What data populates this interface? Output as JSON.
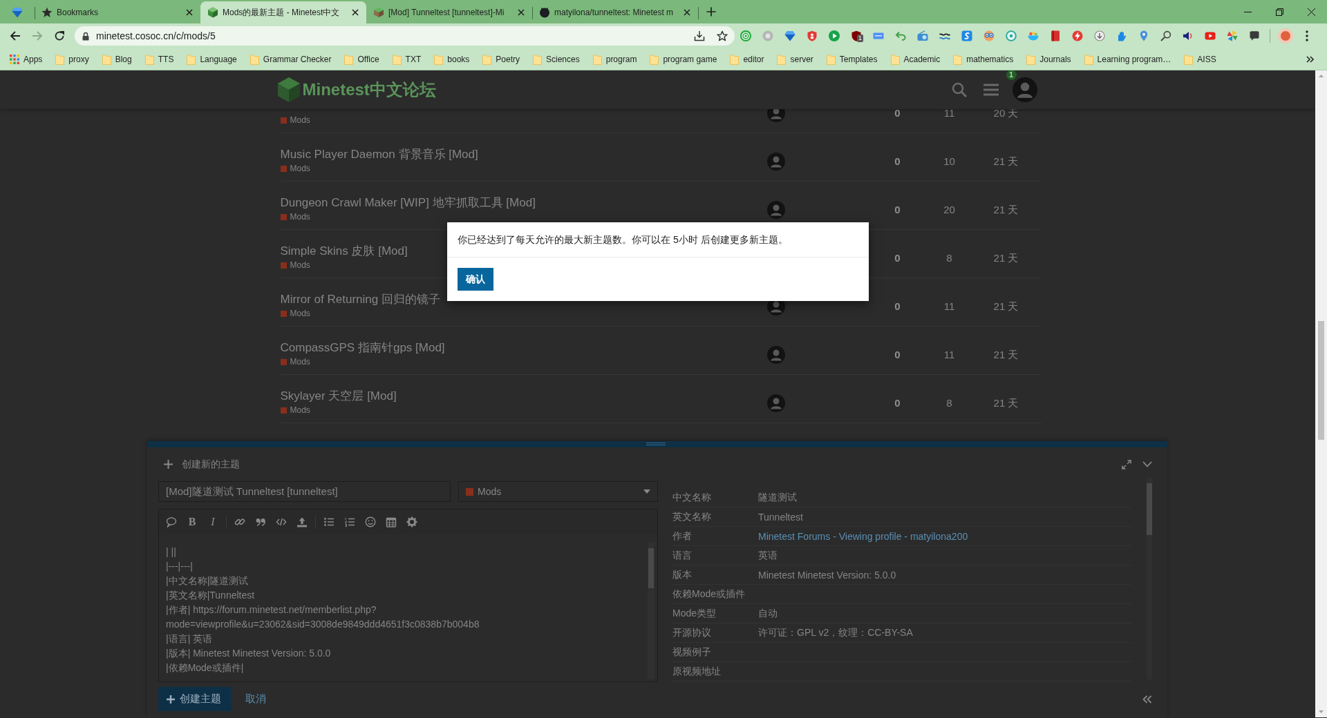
{
  "browser": {
    "tabs": [
      {
        "selected": false
      },
      {
        "title": "Bookmarks",
        "selected": false
      },
      {
        "title": "Mods的最新主题 - Minetest中文",
        "selected": true
      },
      {
        "title": "[Mod] Tunneltest [tunneltest]-Mi",
        "selected": false
      },
      {
        "title": "matyilona/tunneltest: Minetest m",
        "selected": false
      }
    ],
    "can_go_forward": false,
    "url": "minetest.cosoc.cn/c/mods/5",
    "extension_badge": "1",
    "bookmarks": [
      {
        "kind": "apps",
        "label": "Apps"
      },
      {
        "kind": "folder",
        "label": "proxy"
      },
      {
        "kind": "folder",
        "label": "Blog"
      },
      {
        "kind": "folder",
        "label": "TTS"
      },
      {
        "kind": "folder",
        "label": "Language"
      },
      {
        "kind": "folder",
        "label": "Grammar Checker"
      },
      {
        "kind": "folder",
        "label": "Office"
      },
      {
        "kind": "folder",
        "label": "TXT"
      },
      {
        "kind": "folder",
        "label": "books"
      },
      {
        "kind": "folder",
        "label": "Poetry"
      },
      {
        "kind": "folder",
        "label": "Sciences"
      },
      {
        "kind": "folder",
        "label": "program"
      },
      {
        "kind": "folder",
        "label": "program game"
      },
      {
        "kind": "folder",
        "label": "editor"
      },
      {
        "kind": "folder",
        "label": "server"
      },
      {
        "kind": "folder",
        "label": "Templates"
      },
      {
        "kind": "folder",
        "label": "Academic"
      },
      {
        "kind": "folder",
        "label": "mathematics"
      },
      {
        "kind": "folder",
        "label": "Journals"
      },
      {
        "kind": "folder",
        "label": "Learning program…"
      },
      {
        "kind": "folder",
        "label": "AISS"
      }
    ]
  },
  "header": {
    "site_title": "Minetest中文论坛",
    "notification_count": "1"
  },
  "topics": [
    {
      "category": "Mods",
      "avatar_shown": true,
      "replies": "0",
      "views": "11",
      "activity": "20 天"
    },
    {
      "title": "Music Player Daemon 背景音乐 [Mod]",
      "category": "Mods",
      "avatar_shown": true,
      "replies": "0",
      "views": "10",
      "activity": "21 天"
    },
    {
      "title": "Dungeon Crawl Maker [WIP] 地牢抓取工具 [Mod]",
      "category": "Mods",
      "avatar_shown": true,
      "replies": "0",
      "views": "20",
      "activity": "21 天"
    },
    {
      "title": "Simple Skins 皮肤 [Mod]",
      "category": "Mods",
      "avatar_shown": false,
      "replies": "0",
      "views": "8",
      "activity": "21 天"
    },
    {
      "title": "Mirror of Returning 回归的镜子",
      "category": "Mods",
      "avatar_shown": true,
      "replies": "0",
      "views": "11",
      "activity": "21 天"
    },
    {
      "title": "CompassGPS 指南针gps [Mod]",
      "category": "Mods",
      "avatar_shown": true,
      "replies": "0",
      "views": "11",
      "activity": "21 天"
    },
    {
      "title": "Skylayer 天空层 [Mod]",
      "category": "Mods",
      "avatar_shown": true,
      "replies": "0",
      "views": "8",
      "activity": "21 天"
    }
  ],
  "composer": {
    "heading": "创建新的主题",
    "title_value": "[Mod]隧道测试 Tunneltest [tunneltest]",
    "category": "Mods",
    "format_buttons": [
      "B",
      "I"
    ],
    "editor_lines": [
      "| ||",
      "|---|---|",
      "|中文名称|隧道测试",
      "|英文名称|Tunneltest",
      "|作者| https://forum.minetest.net/memberlist.php?",
      "mode=viewprofile&u=23062&sid=3008de9849ddd4651f3c0838b7b004b8",
      "|语言| 英语",
      "|版本| Minetest Minetest Version: 5.0.0",
      "|依赖Mode或插件|"
    ],
    "preview": [
      {
        "kind": "text",
        "label": "中文名称",
        "value": "隧道测试"
      },
      {
        "kind": "text",
        "label": "英文名称",
        "value": "Tunneltest"
      },
      {
        "kind": "link",
        "label": "作者",
        "value": "Minetest Forums - Viewing profile - matyilona200"
      },
      {
        "kind": "text",
        "label": "语言",
        "value": "英语"
      },
      {
        "kind": "text",
        "label": "版本",
        "value": "Minetest Minetest Version: 5.0.0"
      },
      {
        "label": "依赖Mode或插件"
      },
      {
        "kind": "text",
        "label": "Mode类型",
        "value": "自动"
      },
      {
        "kind": "text",
        "label": "开源协议",
        "value": "许可证：GPL v2，纹理：CC-BY-SA"
      },
      {
        "label": "视频例子"
      },
      {
        "label": "原视频地址"
      }
    ],
    "submit_label": "创建主题",
    "cancel_label": "取消"
  },
  "dialog": {
    "message": "你已经达到了每天允许的最大新主题数。你可以在 5小时 后创建更多新主题。",
    "button": "确认"
  }
}
